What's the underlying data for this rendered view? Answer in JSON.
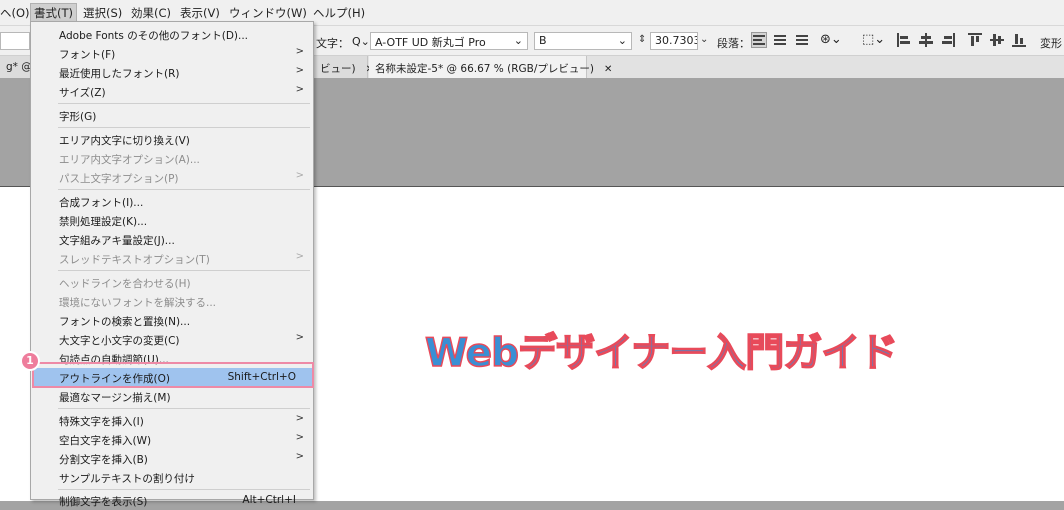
{
  "menubar": {
    "items": [
      "ヘ(O)",
      "書式(T)",
      "選択(S)",
      "効果(C)",
      "表示(V)",
      "ウィンドウ(W)",
      "ヘルプ(H)"
    ]
  },
  "controlbar": {
    "char_label": "文字：",
    "font_family": "A-OTF UD 新丸ゴ Pro",
    "font_style": "B",
    "font_size": "30.7303",
    "para_label": "段落：",
    "transform_label": "変形"
  },
  "tabs": [
    {
      "label": "g* @ 6"
    },
    {
      "label": "ビュー)"
    },
    {
      "label": "名称未設定-5* @ 66.67 % (RGB/プレビュー)"
    }
  ],
  "artboard": {
    "text": "Webデザイナー入門ガイド",
    "fill_color": "#3a8fd4",
    "stroke_color": "#e84a5a"
  },
  "menu": {
    "items": [
      {
        "label": "Adobe Fonts のその他のフォント(D)...",
        "disabled": false
      },
      {
        "label": "フォント(F)",
        "disabled": false,
        "submenu": true
      },
      {
        "label": "最近使用したフォント(R)",
        "disabled": false,
        "submenu": true
      },
      {
        "label": "サイズ(Z)",
        "disabled": false,
        "submenu": true
      },
      {
        "label": "字形(G)",
        "disabled": false
      },
      {
        "label": "エリア内文字に切り換え(V)",
        "disabled": false
      },
      {
        "label": "エリア内文字オプション(A)...",
        "disabled": true
      },
      {
        "label": "パス上文字オプション(P)",
        "disabled": true,
        "submenu": true
      },
      {
        "label": "合成フォント(I)...",
        "disabled": false
      },
      {
        "label": "禁則処理設定(K)...",
        "disabled": false
      },
      {
        "label": "文字組みアキ量設定(J)...",
        "disabled": false
      },
      {
        "label": "スレッドテキストオプション(T)",
        "disabled": true,
        "submenu": true
      },
      {
        "label": "ヘッドラインを合わせる(H)",
        "disabled": true
      },
      {
        "label": "環境にないフォントを解決する...",
        "disabled": true
      },
      {
        "label": "フォントの検索と置換(N)...",
        "disabled": false
      },
      {
        "label": "大文字と小文字の変更(C)",
        "disabled": false,
        "submenu": true
      },
      {
        "label": "句読点の自動調節(U)...",
        "disabled": false
      },
      {
        "label": "アウトラインを作成(O)",
        "disabled": false,
        "shortcut": "Shift+Ctrl+O",
        "highlighted": true
      },
      {
        "label": "最適なマージン揃え(M)",
        "disabled": false
      },
      {
        "label": "特殊文字を挿入(I)",
        "disabled": false,
        "submenu": true
      },
      {
        "label": "空白文字を挿入(W)",
        "disabled": false,
        "submenu": true
      },
      {
        "label": "分割文字を挿入(B)",
        "disabled": false,
        "submenu": true
      },
      {
        "label": "サンプルテキストの割り付け",
        "disabled": false
      },
      {
        "label": "制御文字を表示(S)",
        "disabled": false,
        "shortcut": "Alt+Ctrl+I"
      }
    ]
  },
  "annotation": {
    "badge_number": "1",
    "highlight_color": "#ee8aa6"
  }
}
